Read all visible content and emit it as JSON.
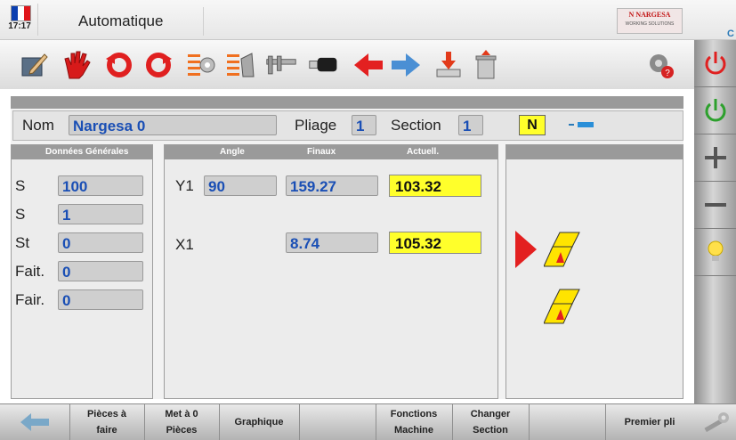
{
  "header": {
    "time": "17:17",
    "title": "Automatique",
    "logo_line1": "N NARGESA",
    "logo_line2": "WORKING SOLUTIONS",
    "corner_letter": "C",
    "flag_colors": [
      "#0b3fb0",
      "#ffffff",
      "#e0161c"
    ]
  },
  "toolbar": {
    "icons": [
      "edit-icon",
      "hand-icon",
      "rotate-ccw-icon",
      "rotate-cw-icon",
      "list-icon",
      "list-bend-icon",
      "caliper-icon",
      "usb-icon",
      "arrow-left-icon",
      "arrow-right-icon",
      "download-icon",
      "delete-icon",
      "settings-help-icon"
    ]
  },
  "right_buttons": [
    "power-red-icon",
    "power-green-icon",
    "plus-icon",
    "minus-icon",
    "lightbulb-icon"
  ],
  "name_row": {
    "nom_label": "Nom",
    "nom_value": "Nargesa 0",
    "pliage_label": "Pliage",
    "pliage_value": "1",
    "section_label": "Section",
    "section_value": "1",
    "n_badge": "N"
  },
  "general": {
    "title": "Données Générales",
    "rows": [
      {
        "label": "S",
        "value": "100"
      },
      {
        "label": "S",
        "value": "1"
      },
      {
        "label": "St",
        "value": "0"
      },
      {
        "label": "Fait.",
        "value": "0"
      },
      {
        "label": "Fair.",
        "value": "0"
      }
    ]
  },
  "axes": {
    "col_angle": "Angle",
    "col_finaux": "Finaux",
    "col_actuel": "Actuell.",
    "rows": [
      {
        "label": "Y1",
        "angle": "90",
        "finaux": "159.27",
        "actuel": "103.32"
      },
      {
        "label": "X1",
        "angle": "",
        "finaux": "8.74",
        "actuel": "105.32"
      }
    ]
  },
  "bottom": {
    "buttons": [
      {
        "line1": "Pièces à",
        "line2": "faire"
      },
      {
        "line1": "Met à 0",
        "line2": "Pièces"
      },
      {
        "line1": "Graphique",
        "line2": ""
      },
      {
        "line1": "Fonctions",
        "line2": "Machine"
      },
      {
        "line1": "Changer",
        "line2": "Section"
      },
      {
        "line1": "Premier pli",
        "line2": ""
      }
    ]
  }
}
